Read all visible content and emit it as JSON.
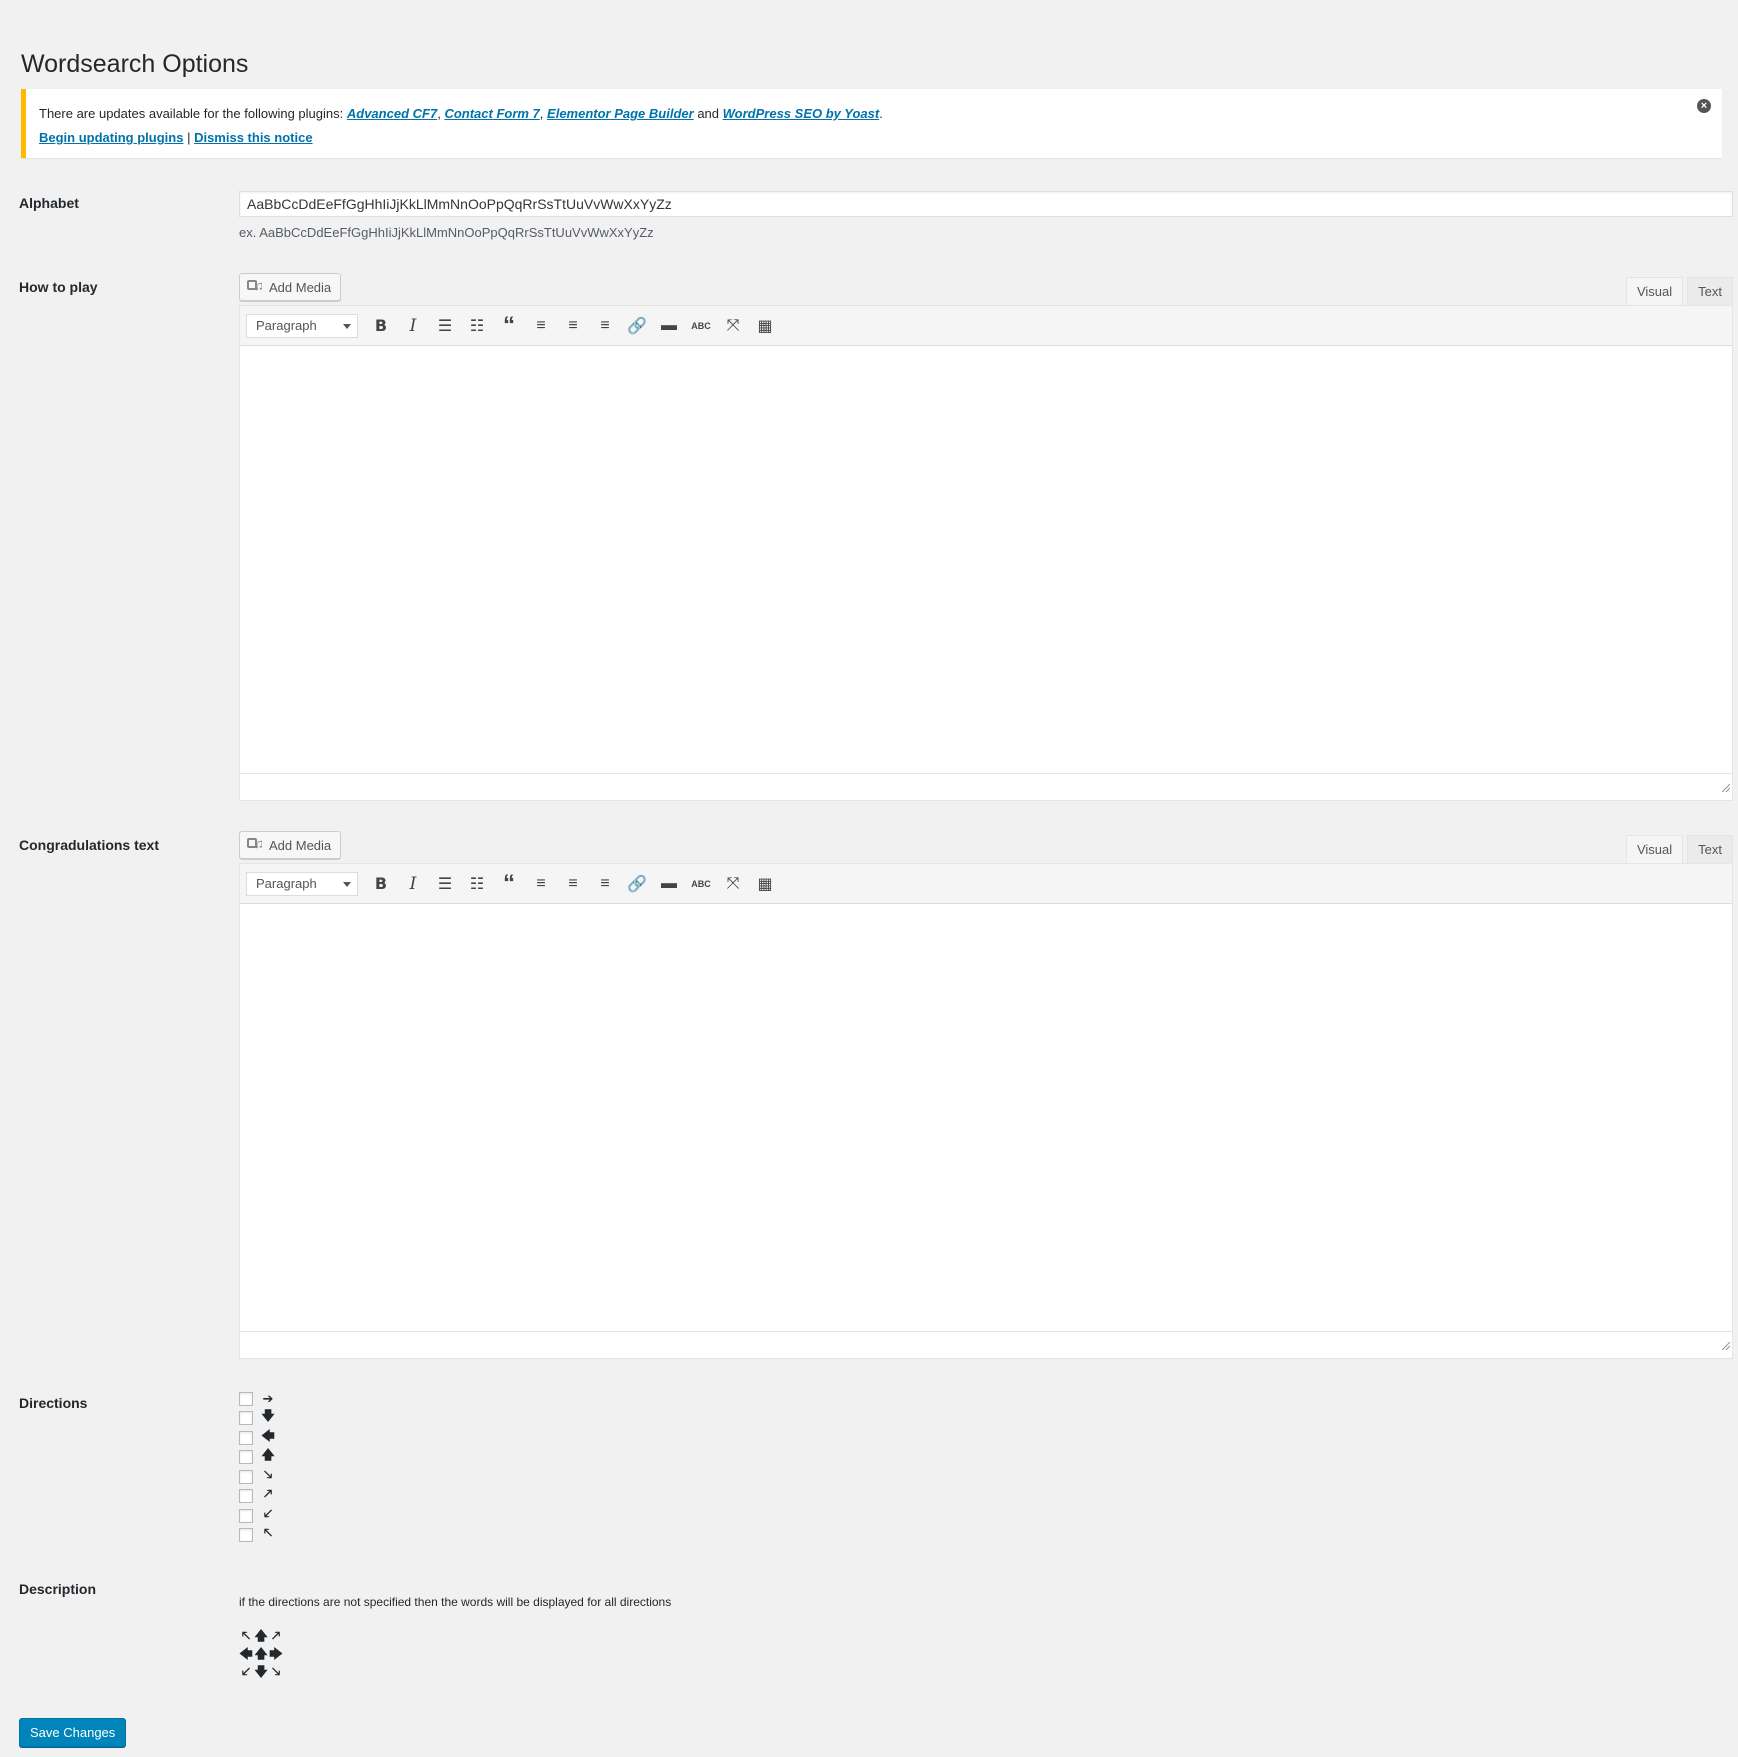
{
  "page": {
    "title": "Wordsearch Options"
  },
  "notice": {
    "text_prefix": "There are updates available for the following plugins:",
    "plugins": [
      "Advanced CF7",
      "Contact Form 7",
      "Elementor Page Builder",
      "WordPress SEO by Yoast"
    ],
    "sep_comma": ",",
    "sep_and": "and",
    "end_period": ".",
    "begin_link": "Begin updating plugins",
    "divider": "|",
    "dismiss_link": "Dismiss this notice",
    "close_glyph": "×"
  },
  "alphabet": {
    "label": "Alphabet",
    "value": "AaBbCcDdEeFfGgHhIiJjKkLlMmNnOoPpQqRrSsTtUuVvWwXxYyZz",
    "example": "ex. AaBbCcDdEeFfGgHhIiJjKkLlMmNnOoPpQqRrSsTtUuVvWwXxYyZz"
  },
  "how_to_play": {
    "label": "How to play",
    "add_media": "Add Media",
    "tabs": [
      "Visual",
      "Text"
    ],
    "format": "Paragraph"
  },
  "congrats": {
    "label": "Congradulations text",
    "add_media": "Add Media",
    "tabs": [
      "Visual",
      "Text"
    ],
    "format": "Paragraph"
  },
  "toolbar_glyphs": {
    "bold": "B",
    "italic": "I",
    "bullet_list": "☰",
    "numbered_list": "☷",
    "blockquote": "“",
    "align_left": "≡",
    "align_center": "≡",
    "align_right": "≡",
    "link": "🔗",
    "more": "▬",
    "spellcheck": "ABC",
    "fullscreen": "⤧",
    "kitchen_sink": "▦"
  },
  "directions": {
    "label": "Directions",
    "arrows": [
      "➔",
      "🡇",
      "🡄",
      "🡅",
      "🡖",
      "🡕",
      "🡗",
      "🡔"
    ]
  },
  "description": {
    "label": "Description",
    "text": "if the directions are not specified then the words will be displayed for all directions",
    "grid": [
      "🡔",
      "🡅",
      "🡕",
      "🡄",
      "🡅",
      "🡆",
      "🡗",
      "🡇",
      "🡖"
    ]
  },
  "save_label": "Save Changes",
  "colors": {
    "accent": "#0085ba",
    "link": "#0073aa",
    "notice_border": "#ffb900"
  }
}
